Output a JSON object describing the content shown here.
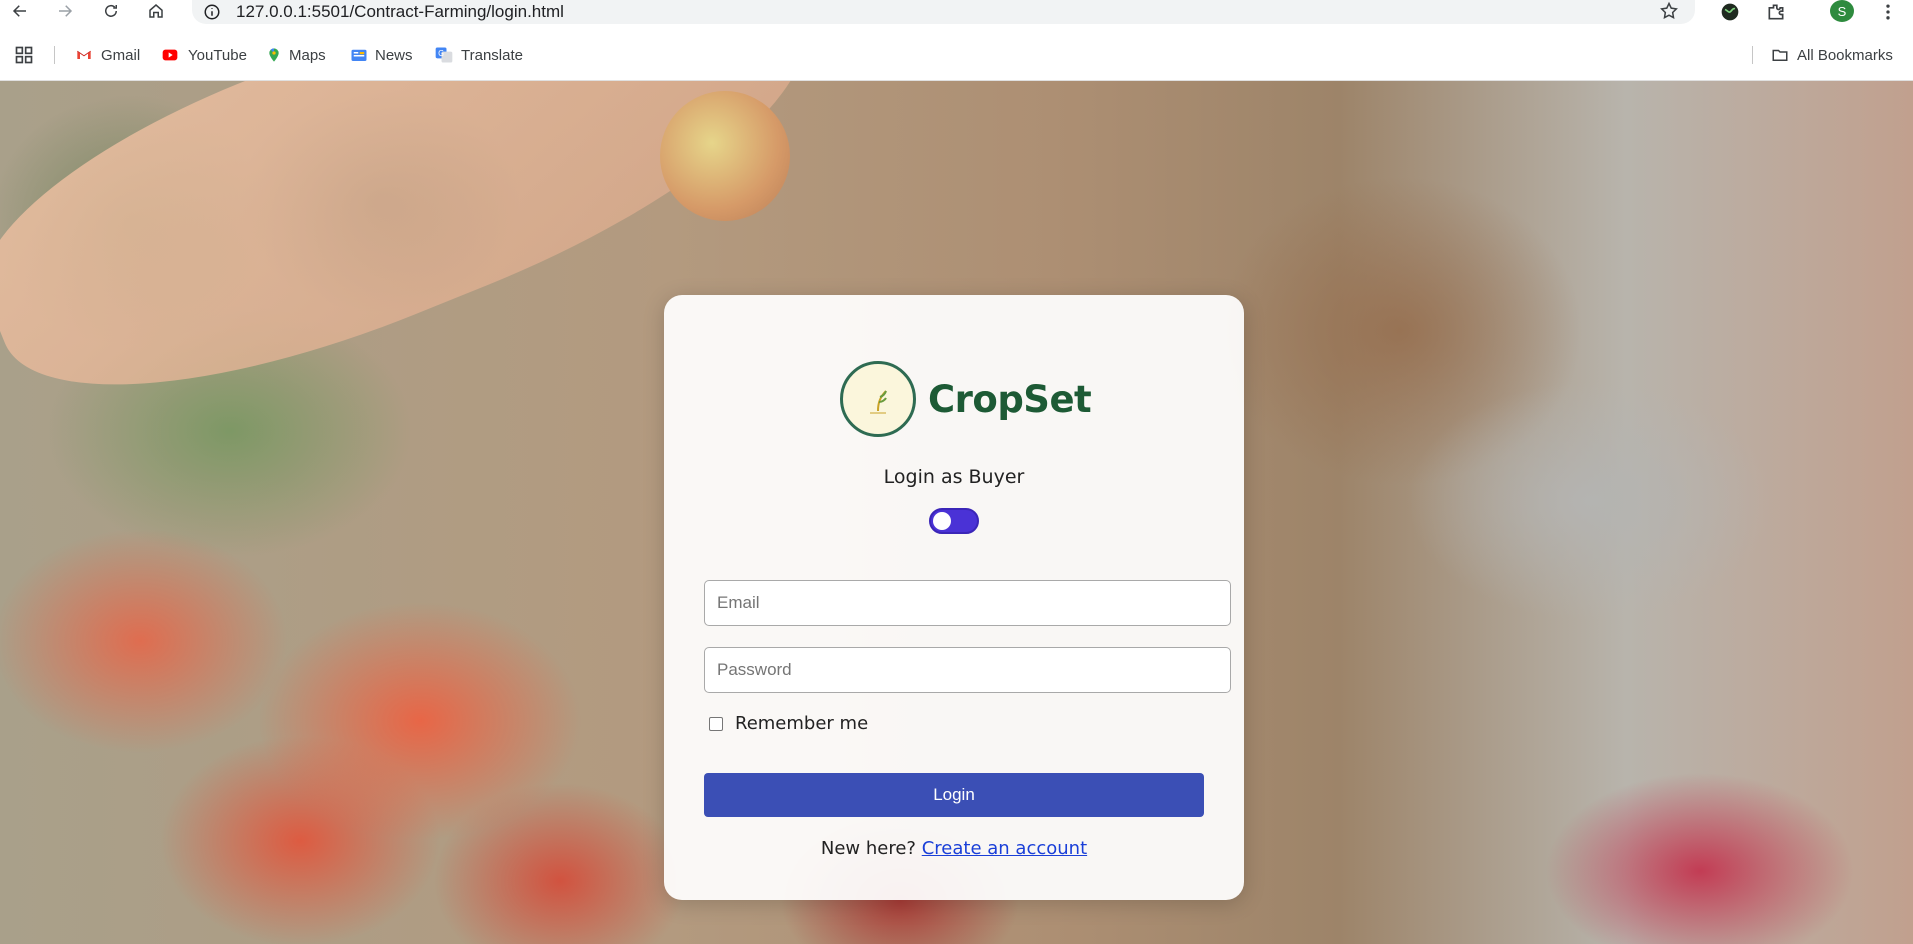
{
  "browser": {
    "url_host": "127.0.0.1",
    "url_path": ":5501/Contract-Farming/login.html",
    "profile_initial": "S",
    "bookmarks": [
      {
        "label": "Gmail",
        "icon": "gmail-icon"
      },
      {
        "label": "YouTube",
        "icon": "youtube-icon"
      },
      {
        "label": "Maps",
        "icon": "maps-icon"
      },
      {
        "label": "News",
        "icon": "news-icon"
      },
      {
        "label": "Translate",
        "icon": "translate-icon"
      }
    ],
    "all_bookmarks_label": "All Bookmarks"
  },
  "login": {
    "brand_name": "CropSet",
    "mode_title": "Login as Buyer",
    "mode_toggle_on": true,
    "email_placeholder": "Email",
    "password_placeholder": "Password",
    "remember_label": "Remember me",
    "submit_label": "Login",
    "signup_prompt": "New here?",
    "signup_link": "Create an account"
  },
  "colors": {
    "brand_green": "#1d5a35",
    "toggle_active": "#4a32d6",
    "button_primary": "#3b4fb5",
    "link": "#1a3fd8"
  }
}
